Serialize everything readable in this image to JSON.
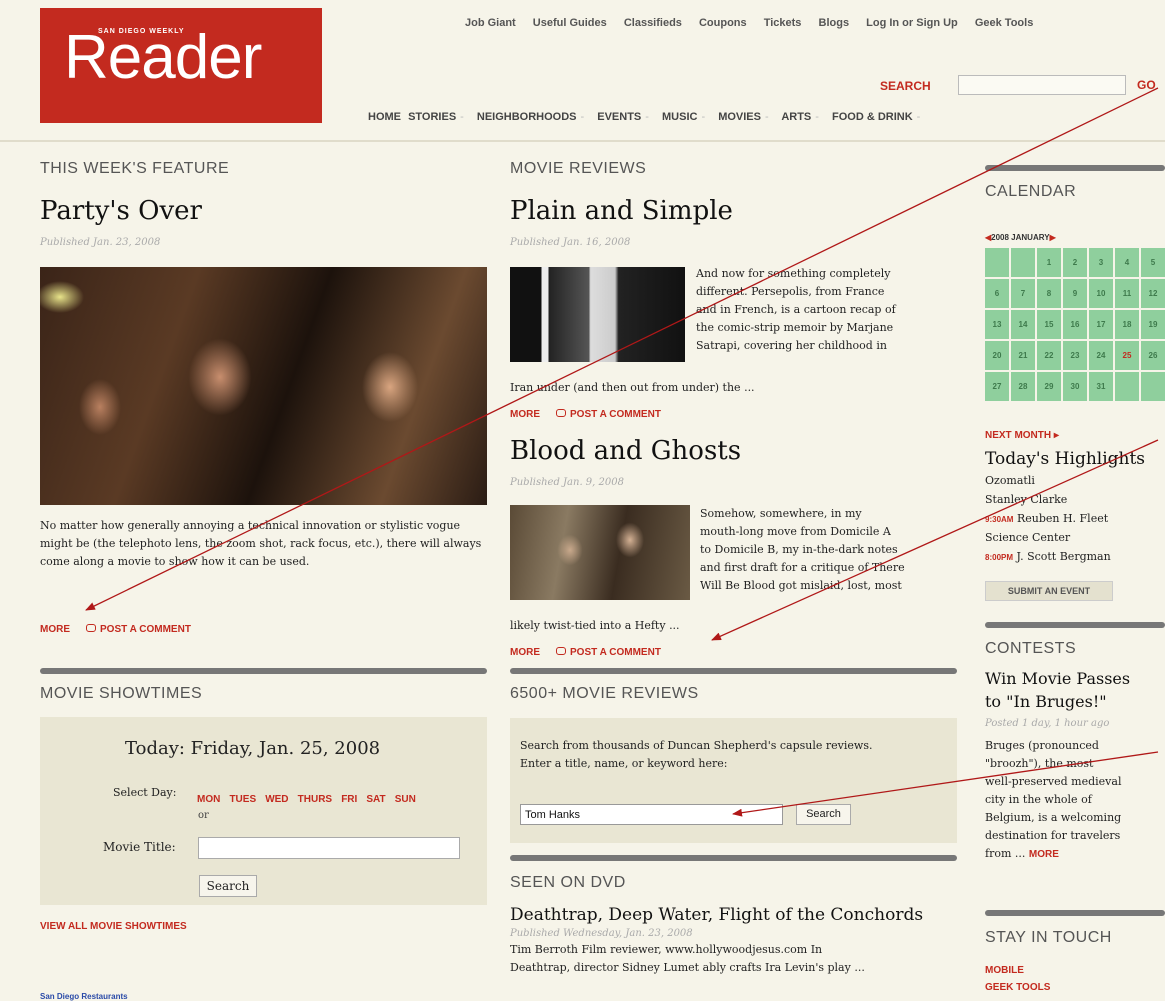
{
  "header": {
    "logo_small": "SAN DIEGO WEEKLY",
    "logo_big": "Reader",
    "util_links": [
      "Job Giant",
      "Useful Guides",
      "Classifieds",
      "Coupons",
      "Tickets",
      "Blogs",
      "Log In or Sign Up",
      "Geek Tools"
    ],
    "search_label": "SEARCH",
    "search_value": "",
    "go_label": "GO",
    "nav": [
      "HOME",
      "STORIES",
      "NEIGHBORHOODS",
      "EVENTS",
      "MUSIC",
      "MOVIES",
      "ARTS",
      "FOOD & DRINK"
    ]
  },
  "feature": {
    "section": "THIS WEEK'S FEATURE",
    "title": "Party's Over",
    "published": "Published Jan. 23, 2008",
    "text": "No matter how generally annoying a technical innovation or stylistic vogue might be (the telephoto lens, the zoom shot, rack focus, etc.), there will always come along a movie to show how it can be used.",
    "more": "MORE",
    "comment": "POST A COMMENT"
  },
  "showtimes": {
    "section": "MOVIE SHOWTIMES",
    "today": "Today:  Friday, Jan. 25, 2008",
    "select_day": "Select Day:",
    "days": [
      "MON",
      "TUES",
      "WED",
      "THURS",
      "FRI",
      "SAT",
      "SUN"
    ],
    "or": "or",
    "movie_title_label": "Movie Title:",
    "movie_title_value": "",
    "search_button": "Search",
    "view_all": "VIEW ALL MOVIE SHOWTIMES",
    "footer_link": "San Diego Restaurants"
  },
  "reviews": {
    "section": "MOVIE REVIEWS",
    "items": [
      {
        "title": "Plain and Simple",
        "published": "Published Jan. 16, 2008",
        "text_lines": [
          "And now for something completely",
          "different. Persepolis, from France",
          "and in French, is a cartoon recap of",
          "the comic-strip memoir by Marjane",
          "Satrapi, covering her childhood in"
        ],
        "text_tail": "Iran under (and then out from under) the ...",
        "more": "MORE",
        "comment": "POST A COMMENT"
      },
      {
        "title": "Blood and Ghosts",
        "published": "Published Jan. 9, 2008",
        "text_lines": [
          "Somehow, somewhere, in my",
          "mouth-long move from Domicile A",
          "to Domicile B, my in-the-dark notes",
          "and first draft for a critique of There",
          "Will Be Blood got mislaid, lost, most"
        ],
        "text_tail": "likely twist-tied into a Hefty ...",
        "more": "MORE",
        "comment": "POST A COMMENT"
      }
    ]
  },
  "capsule": {
    "section": "6500+ MOVIE REVIEWS",
    "intro": "Search from thousands of Duncan Shepherd's capsule reviews. Enter a title, name, or keyword here:",
    "input_value": "Tom Hanks",
    "search_button": "Search"
  },
  "dvd": {
    "section": "SEEN ON DVD",
    "title": "Deathtrap, Deep Water, Flight of the Conchords",
    "published": "Published Wednesday, Jan. 23, 2008",
    "text_lines": [
      "Tim Berroth Film reviewer, www.hollywoodjesus.com In",
      "Deathtrap, director Sidney Lumet ably crafts Ira Levin's play ..."
    ]
  },
  "calendar": {
    "section": "CALENDAR",
    "month_label": "2008 JANUARY",
    "prev_icon": "triangle-left-icon",
    "next_icon": "triangle-right-icon",
    "days": [
      "",
      "",
      "1",
      "2",
      "3",
      "4",
      "5",
      "6",
      "7",
      "8",
      "9",
      "10",
      "11",
      "12",
      "13",
      "14",
      "15",
      "16",
      "17",
      "18",
      "19",
      "20",
      "21",
      "22",
      "23",
      "24",
      "25",
      "26",
      "27",
      "28",
      "29",
      "30",
      "31",
      "",
      ""
    ],
    "today": "25",
    "next_month": "NEXT MONTH",
    "colors": {
      "cell": "#8fcf9d",
      "accent": "#c32a1f"
    }
  },
  "highlights": {
    "title": "Today's Highlights",
    "lines": [
      {
        "time": "",
        "text": "Ozomatli"
      },
      {
        "time": "",
        "text": "Stanley Clarke"
      },
      {
        "time": "9:30AM",
        "text": "Reuben H. Fleet"
      },
      {
        "time": "",
        "text": "Science Center"
      },
      {
        "time": "8:00PM",
        "text": "J. Scott Bergman"
      }
    ],
    "submit": "SUBMIT AN EVENT"
  },
  "contests": {
    "section": "CONTESTS",
    "title_1": "Win Movie Passes",
    "title_2": "to \"In Bruges!\"",
    "posted": "Posted 1 day, 1 hour ago",
    "text_lines": [
      "Bruges (pronounced",
      "\"broozh\"), the most",
      "well-preserved medieval",
      "city in the whole of",
      "Belgium, is a welcoming",
      "destination for travelers"
    ],
    "text_tail": "from ...",
    "more": "MORE"
  },
  "stay": {
    "section": "STAY IN TOUCH",
    "links": [
      "MOBILE",
      "GEEK TOOLS"
    ]
  }
}
